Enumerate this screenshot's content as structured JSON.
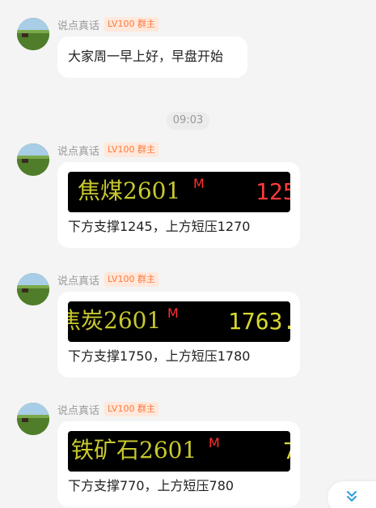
{
  "sender": {
    "name": "说点真话",
    "badge": "LV100 群主"
  },
  "time_separator": "09:03",
  "messages": [
    {
      "type": "text",
      "text": "大家周一早上好，早盘开始"
    },
    {
      "type": "ticker",
      "ticker_name": "焦煤2601",
      "ticker_m": "M",
      "ticker_price": "125",
      "price_color": "#ff3a3a",
      "caption": "下方支撑1245，上方短压1270"
    },
    {
      "type": "ticker",
      "ticker_name": "焦炭2601",
      "ticker_m": "M",
      "ticker_price": "1763.",
      "price_color": "#d8d830",
      "caption": "下方支撑1750，上方短压1780"
    },
    {
      "type": "ticker",
      "ticker_name": "铁矿石2601",
      "ticker_m": "M",
      "ticker_price": "7",
      "price_color": "#d8d830",
      "caption": "下方支撑770，上方短压780"
    }
  ],
  "icons": {
    "scroll_down": "double-chevron-down-icon"
  },
  "colors": {
    "accent": "#2a9ee0",
    "badge_text": "#ff7a3c",
    "badge_bg": "#ffe8dc"
  }
}
